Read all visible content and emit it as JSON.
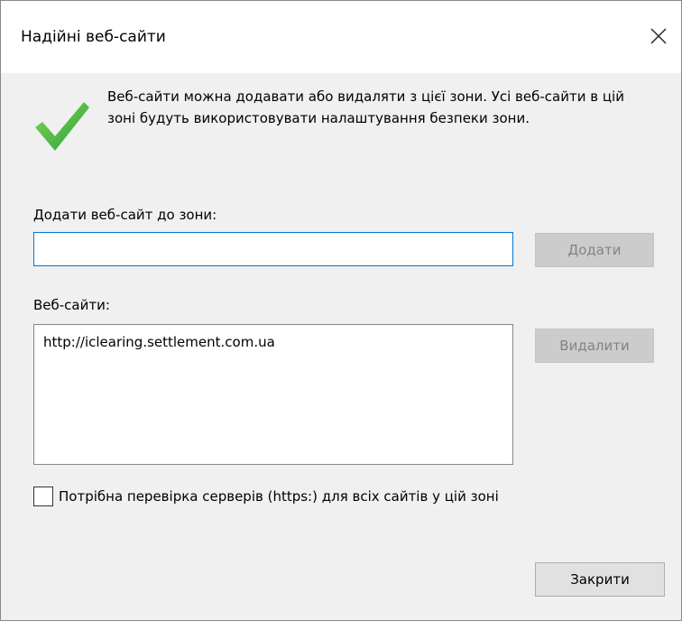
{
  "window": {
    "title": "Надійні веб-сайти"
  },
  "description": "Веб-сайти можна додавати або видаляти з цієї зони. Усі веб-сайти в цій зоні будуть використовувати налаштування безпеки зони.",
  "add_section": {
    "label": "Додати веб-сайт до зони:",
    "input_value": "",
    "add_button": "Додати"
  },
  "sites_section": {
    "label": "Веб-сайти:",
    "items": [
      "http://iclearing.settlement.com.ua"
    ],
    "remove_button": "Видалити"
  },
  "https_checkbox": {
    "label": "Потрібна перевірка серверів (https:) для всіх сайтів у цій зоні",
    "checked": false
  },
  "footer": {
    "close_button": "Закрити"
  },
  "colors": {
    "accent": "#0078d7",
    "check_green": "#45b649"
  },
  "icons": {
    "status": "checkmark-icon",
    "close": "close-icon"
  }
}
